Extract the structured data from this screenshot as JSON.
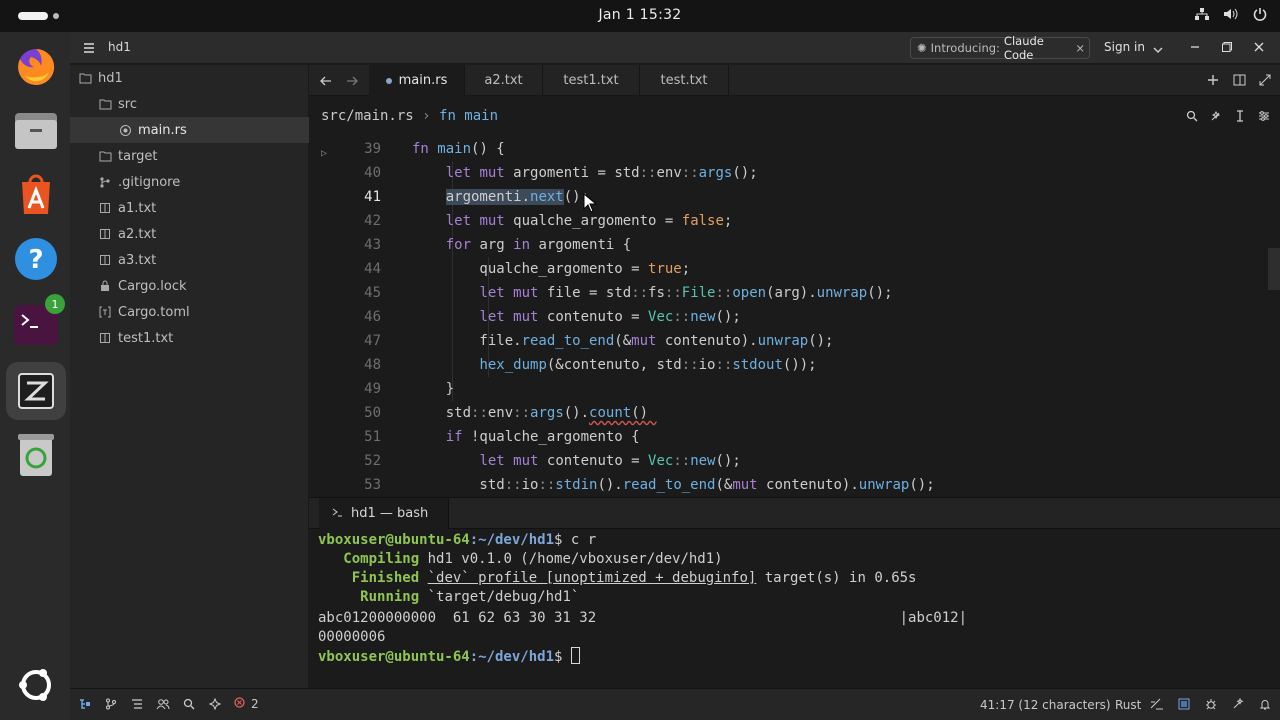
{
  "topbar": {
    "clock": "Jan 1  15:32"
  },
  "titlebar": {
    "project": "hd1",
    "intro_prefix": "Introducing:",
    "intro_name": "Claude Code",
    "sign_in": "Sign in"
  },
  "tree": [
    {
      "label": "hd1",
      "icon": "folder-open-icon"
    },
    {
      "label": "src",
      "icon": "folder-open-icon"
    },
    {
      "label": "main.rs",
      "icon": "rust-file-icon"
    },
    {
      "label": "target",
      "icon": "folder-icon"
    },
    {
      "label": ".gitignore",
      "icon": "git-icon"
    },
    {
      "label": "a1.txt",
      "icon": "book-icon"
    },
    {
      "label": "a2.txt",
      "icon": "book-icon"
    },
    {
      "label": "a3.txt",
      "icon": "book-icon"
    },
    {
      "label": "Cargo.lock",
      "icon": "lock-icon"
    },
    {
      "label": "Cargo.toml",
      "icon": "toml-icon"
    },
    {
      "label": "test1.txt",
      "icon": "book-icon"
    }
  ],
  "tabs": [
    {
      "label": "main.rs"
    },
    {
      "label": "a2.txt"
    },
    {
      "label": "test1.txt"
    },
    {
      "label": "test.txt"
    }
  ],
  "breadcrumb": {
    "path": "src/main.rs",
    "sep": " › ",
    "symbol": "fn main"
  },
  "editor": {
    "line_numbers": [
      "39",
      "40",
      "41",
      "42",
      "43",
      "44",
      "45",
      "46",
      "47",
      "48",
      "49",
      "50",
      "51",
      "52",
      "53"
    ],
    "current_line": "41"
  },
  "terminal": {
    "tab": "hd1 — bash",
    "prompt_user": "vboxuser@ubuntu-64",
    "prompt_path": ":~/dev/hd1",
    "prompt_sym": "$ ",
    "cmd": "c r",
    "compiling_label": "Compiling",
    "compiling_text": " hd1 v0.1.0 (/home/vboxuser/dev/hd1)",
    "finished_label": "Finished",
    "finished_profile": "`dev` profile [unoptimized + debuginfo]",
    "finished_rest": " target(s) in 0.65s",
    "running_label": "Running",
    "running_text": " `target/debug/hd1`",
    "out1": "abc01200000000  61 62 63 30 31 32                                    |abc012|",
    "out2": "00000006"
  },
  "statusbar": {
    "errors": "2",
    "position": "41:17 (12 characters)",
    "language": "Rust"
  },
  "dock": {
    "terminal_badge": "1"
  }
}
